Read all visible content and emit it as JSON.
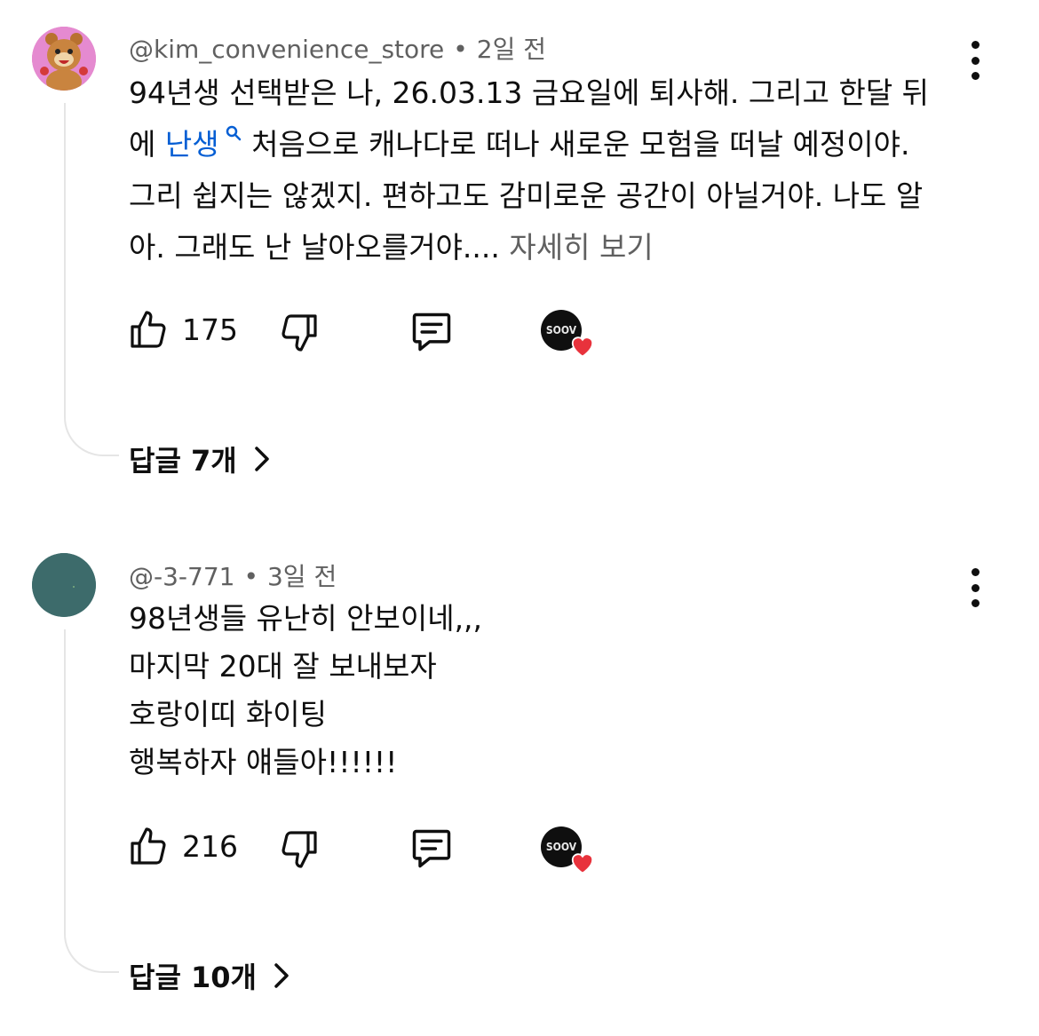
{
  "comments": [
    {
      "author": "@kim_convenience_store",
      "time": "2일 전",
      "text_lines": [
        "94년생 선택받은 나, 26.03.13 금요일에 퇴사해. 그리고 한달 뒤",
        "그리 쉽지는 않겠지. 편하고도 감미로운 공간이 아닐거야. 나도 알",
        "아. 그래도 난 날아오를거야...."
      ],
      "line2_prefix": "에 ",
      "line2_link": "난생",
      "line2_suffix": " 처음으로 캐나다로 떠나 새로운 모험을 떠날 예정이야.",
      "read_more": "자세히 보기",
      "likes": "175",
      "badge": "SOOV",
      "replies": "답글 7개",
      "avatar_icon": "bear-character-avatar"
    },
    {
      "author": "@-3-771",
      "time": "3일 전",
      "text_lines": [
        "98년생들 유난히 안보이네,,,",
        "마지막 20대 잘 보내보자",
        "호랑이띠 화이팅",
        "행복하자 얘들아!!!!!!"
      ],
      "likes": "216",
      "badge": "SOOV",
      "replies": "답글 10개",
      "avatar_icon": "teal-default-avatar"
    }
  ],
  "separator": "•",
  "colors": {
    "text": "#0f0f0f",
    "secondary": "#606060",
    "link": "#065fd4",
    "heart": "#e8323c",
    "teal_avatar": "#3d6b6b"
  },
  "icons": {
    "like": "thumbs-up-icon",
    "dislike": "thumbs-down-icon",
    "reply": "comment-icon",
    "search": "search-icon",
    "more": "more-vertical-icon",
    "chevron": "chevron-right-icon",
    "heart": "heart-icon"
  }
}
